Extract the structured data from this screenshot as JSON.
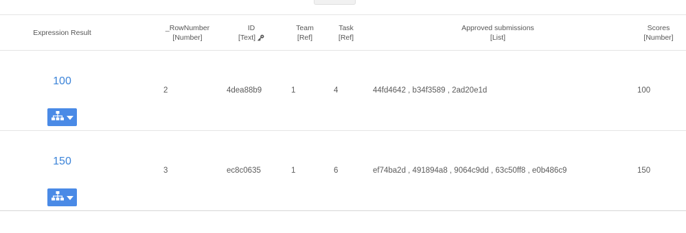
{
  "columns": {
    "expression_result": {
      "title": "Expression Result"
    },
    "row_number": {
      "title": "_RowNumber",
      "type": "[Number]"
    },
    "id": {
      "title": "ID",
      "type": "[Text]"
    },
    "team": {
      "title": "Team",
      "type": "[Ref]"
    },
    "task": {
      "title": "Task",
      "type": "[Ref]"
    },
    "approved": {
      "title": "Approved submissions",
      "type": "[List]"
    },
    "scores": {
      "title": "Scores",
      "type": "[Number]"
    }
  },
  "icons": {
    "key": "key-icon",
    "tree_button": "sitemap-icon",
    "dropdown": "caret-down-icon"
  },
  "colors": {
    "link_blue": "#3b83d8",
    "button_blue": "#4a8ae6",
    "text_gray": "#5a5a5a",
    "border": "#e4e4e4"
  },
  "rows": [
    {
      "expression_result": "100",
      "row_number": "2",
      "id": "4dea88b9",
      "team": "1",
      "task": "4",
      "approved": "44fd4642 , b34f3589 , 2ad20e1d",
      "scores": "100"
    },
    {
      "expression_result": "150",
      "row_number": "3",
      "id": "ec8c0635",
      "team": "1",
      "task": "6",
      "approved": "ef74ba2d , 491894a8 , 9064c9dd , 63c50ff8 , e0b486c9",
      "scores": "150"
    }
  ]
}
